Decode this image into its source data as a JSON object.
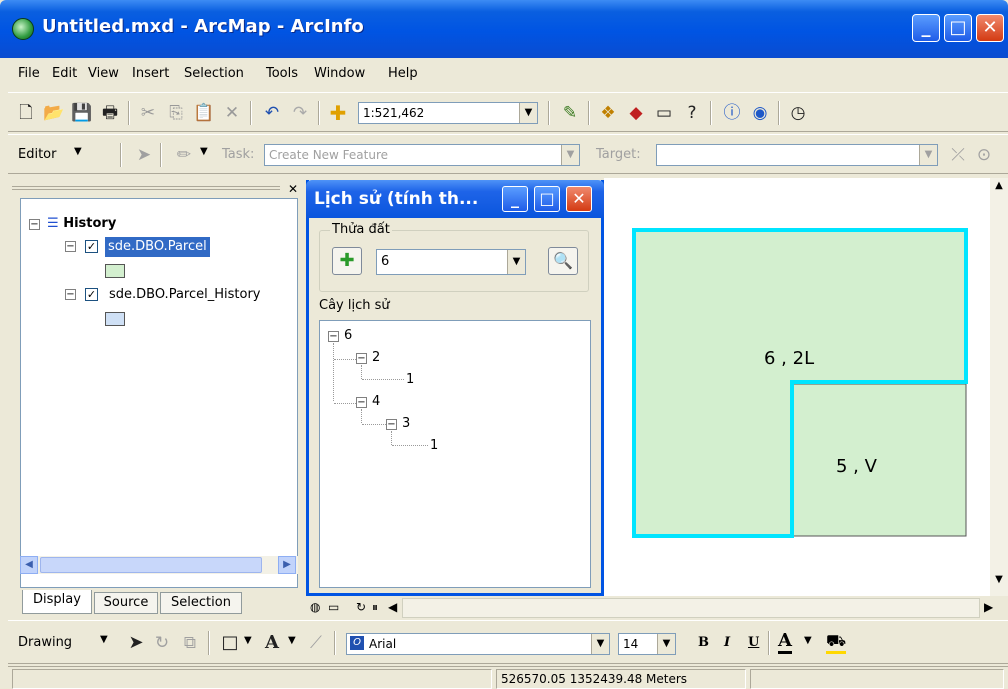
{
  "window": {
    "title": "Untitled.mxd - ArcMap - ArcInfo"
  },
  "menu": [
    "File",
    "Edit",
    "View",
    "Insert",
    "Selection",
    "Tools",
    "Window",
    "Help"
  ],
  "standard_toolbar": {
    "scale": "1:521,462"
  },
  "editor_toolbar": {
    "editor_label": "Editor",
    "task_label": "Task:",
    "task_value": "Create New Feature",
    "target_label": "Target:"
  },
  "toc": {
    "root": "History",
    "layers": [
      {
        "name": "sde.DBO.Parcel",
        "checked": true,
        "swatch": "#d3efcf"
      },
      {
        "name": "sde.DBO.Parcel_History",
        "checked": true,
        "swatch": "#cfe0f5"
      }
    ],
    "tabs": [
      "Display",
      "Source",
      "Selection"
    ]
  },
  "dialog": {
    "title": "Lịch sử (tính th...",
    "group_label": "Thửa đất",
    "parcel_value": "6",
    "tree_label": "Cây lịch sử",
    "tree": [
      {
        "label": "6",
        "level": 0
      },
      {
        "label": "2",
        "level": 1
      },
      {
        "label": "1",
        "level": 2
      },
      {
        "label": "4",
        "level": 1
      },
      {
        "label": "3",
        "level": 2
      },
      {
        "label": "1",
        "level": 3
      }
    ]
  },
  "map": {
    "parcel_fill": "#d3efcf",
    "outline": "#00e5ff",
    "label_parcel_a": "6 , 2L",
    "label_parcel_b": "5 , V"
  },
  "drawing_toolbar": {
    "drawing_label": "Drawing",
    "font": "Arial",
    "font_size": "14",
    "bold": "B",
    "italic": "I",
    "underline": "U",
    "font_color": "A"
  },
  "status": {
    "coords": "526570.05  1352439.48 Meters"
  }
}
